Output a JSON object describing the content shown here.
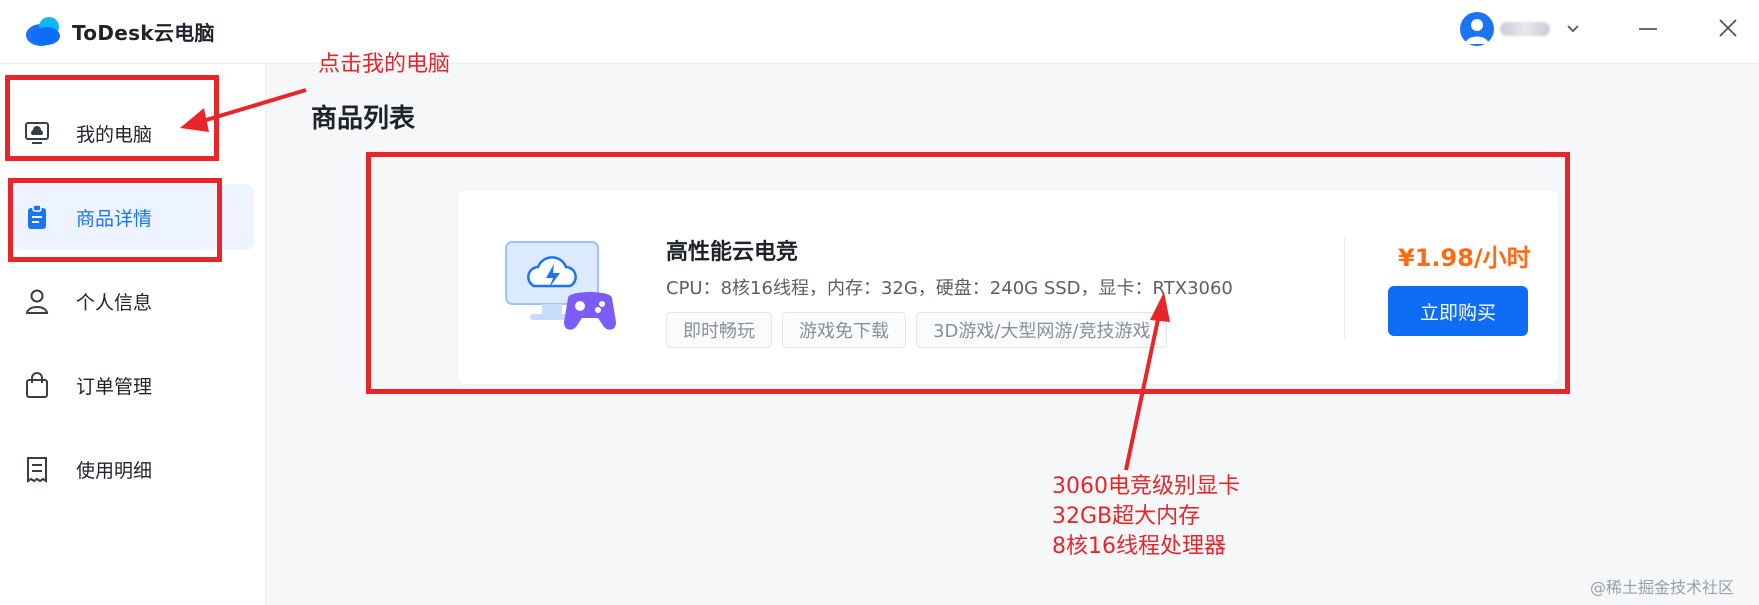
{
  "app": {
    "title": "ToDesk云电脑",
    "accent_color": "#1b74f5"
  },
  "header": {
    "icons": [
      "user-avatar-icon",
      "chevron-down-icon",
      "minimize-icon",
      "close-icon"
    ]
  },
  "sidebar": {
    "items": [
      {
        "label": "我的电脑",
        "icon": "monitor-cloud-icon",
        "active": false
      },
      {
        "label": "商品详情",
        "icon": "clipboard-icon",
        "active": true
      },
      {
        "label": "个人信息",
        "icon": "user-icon",
        "active": false
      },
      {
        "label": "订单管理",
        "icon": "shopping-bag-icon",
        "active": false
      },
      {
        "label": "使用明细",
        "icon": "receipt-icon",
        "active": false
      }
    ]
  },
  "main": {
    "title": "商品列表",
    "product": {
      "name": "高性能云电竞",
      "spec": "CPU：8核16线程，内存：32G，硬盘：240G SSD，显卡：RTX3060",
      "tags": [
        "即时畅玩",
        "游戏免下载",
        "3D游戏/大型网游/竞技游戏"
      ],
      "price": "¥1.98/小时",
      "price_color": "#ff6a13",
      "buy_label": "立即购买"
    }
  },
  "annotations": {
    "click_hint": "点击我的电脑",
    "notes": [
      "3060电竞级别显卡",
      "32GB超大内存",
      "8核16线程处理器"
    ],
    "color": "#e8262a"
  },
  "watermark": "@稀土掘金技术社区"
}
